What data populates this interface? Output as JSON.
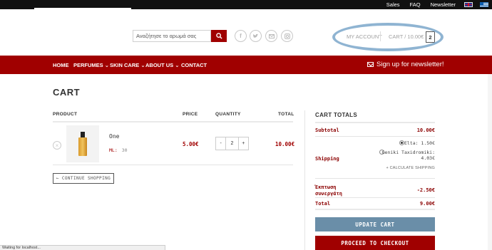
{
  "topbar": {
    "links": [
      "Sales",
      "FAQ",
      "Newsletter"
    ],
    "flags": [
      "uk-flag-icon",
      "greek-flag-icon"
    ]
  },
  "header": {
    "search_placeholder": "Αναζήτησε το αρωμά σας",
    "search_icon": "search-icon",
    "social_icons": [
      "facebook-icon",
      "twitter-icon",
      "email-icon",
      "instagram-icon"
    ],
    "account_label": "MY ACCOUNT",
    "cart_label": "CART / 10.00€",
    "cart_count": "2"
  },
  "nav": {
    "items": [
      {
        "label": "HOME"
      },
      {
        "label": "PERFUMES"
      },
      {
        "label": "SKIN CARE"
      },
      {
        "label": "ABOUT US"
      },
      {
        "label": "CONTACT"
      }
    ],
    "newsletter_label": "Sign up for newsletter!"
  },
  "cart": {
    "title": "CART",
    "headers": {
      "product": "PRODUCT",
      "price": "PRICE",
      "quantity": "QUANTITY",
      "total": "TOTAL"
    },
    "items": [
      {
        "name": "One",
        "meta_label": "ML:",
        "meta_value": "30",
        "price": "5.00€",
        "quantity": "2",
        "total": "10.00€"
      }
    ],
    "qty_minus": "-",
    "qty_plus": "+",
    "remove_symbol": "×",
    "continue_label": "← CONTINUE SHOPPING"
  },
  "totals": {
    "title": "CART TOTALS",
    "subtotal_label": "Subtotal",
    "subtotal_value": "10.00€",
    "shipping_label": "Shipping",
    "shipping_options": [
      {
        "label": "Elta: 1.50€",
        "selected": true
      },
      {
        "label": "Geniki Taxidromiki: 4.03€",
        "selected": false
      }
    ],
    "calc_shipping": "+ CALCULATE SHIPPING",
    "discount_label": "Έκπτωση συνεργάτη",
    "discount_value": "-2.50€",
    "total_label": "Total",
    "total_value": "9.00€",
    "update_label": "UPDATE CART",
    "checkout_label": "PROCEED TO CHECKOUT"
  },
  "status_text": "Waiting for localhost...",
  "colors": {
    "brand": "#a00000",
    "topbar": "#111111",
    "update_button": "#6a8ea8",
    "highlight": "#8fb4d2"
  }
}
